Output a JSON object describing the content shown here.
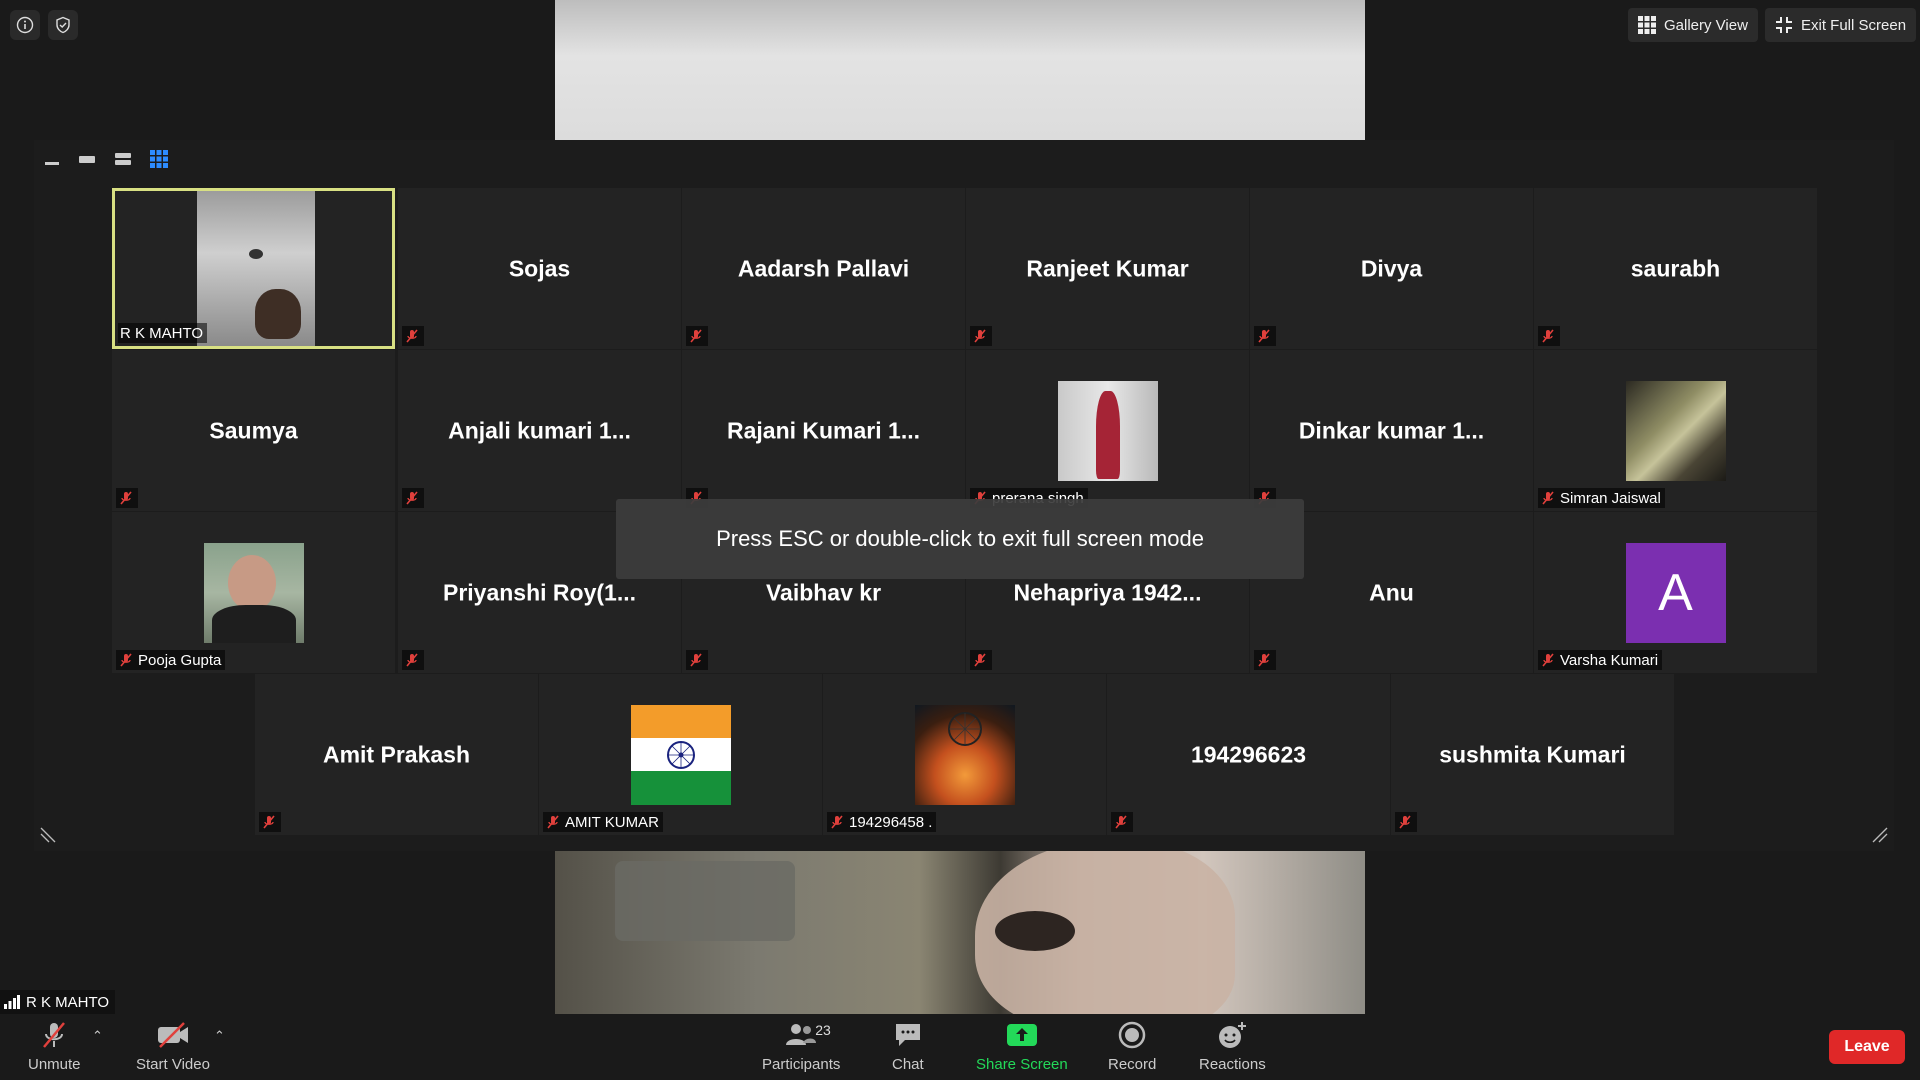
{
  "top": {
    "gallery_view_label": "Gallery View",
    "exit_full_screen_label": "Exit Full Screen"
  },
  "toast": {
    "text": "Press ESC or double-click to exit full screen mode"
  },
  "tiles": [
    {
      "name": "",
      "label": "R K MAHTO",
      "muted": false,
      "active": true
    },
    {
      "name": "Sojas",
      "label": "",
      "muted": true
    },
    {
      "name": "Aadarsh Pallavi",
      "label": "",
      "muted": true
    },
    {
      "name": "Ranjeet Kumar",
      "label": "",
      "muted": true
    },
    {
      "name": "Divya",
      "label": "",
      "muted": true
    },
    {
      "name": "saurabh",
      "label": "",
      "muted": true
    },
    {
      "name": "Saumya",
      "label": "",
      "muted": true
    },
    {
      "name": "Anjali kumari 1...",
      "label": "",
      "muted": true
    },
    {
      "name": "Rajani Kumari 1...",
      "label": "",
      "muted": true
    },
    {
      "name": "",
      "label": "prerana singh",
      "muted": true
    },
    {
      "name": "Dinkar kumar 1...",
      "label": "",
      "muted": true
    },
    {
      "name": "",
      "label": "Simran Jaiswal",
      "muted": true
    },
    {
      "name": "",
      "label": "Pooja Gupta",
      "muted": true
    },
    {
      "name": "Priyanshi Roy(1...",
      "label": "",
      "muted": true
    },
    {
      "name": "Vaibhav kr",
      "label": "",
      "muted": true
    },
    {
      "name": "Nehapriya 1942...",
      "label": "",
      "muted": true
    },
    {
      "name": "Anu",
      "label": "",
      "muted": true
    },
    {
      "name": "",
      "label": "Varsha Kumari",
      "muted": true,
      "avatar_letter": "A"
    },
    {
      "name": "Amit Prakash",
      "label": "",
      "muted": true
    },
    {
      "name": "",
      "label": "AMIT KUMAR",
      "muted": true
    },
    {
      "name": "",
      "label": "194296458 .",
      "muted": true
    },
    {
      "name": "194296623",
      "label": "",
      "muted": true
    },
    {
      "name": "sushmita Kumari",
      "label": "",
      "muted": true
    }
  ],
  "self": {
    "name": "R K MAHTO"
  },
  "toolbar": {
    "unmute": "Unmute",
    "start_video": "Start Video",
    "participants": "Participants",
    "participants_count": "23",
    "chat": "Chat",
    "share_screen": "Share Screen",
    "record": "Record",
    "reactions": "Reactions",
    "leave": "Leave"
  },
  "colors": {
    "active_border": "#d8e083",
    "share_green": "#23d959",
    "leave_red": "#e02828",
    "avatar_purple": "#7b2fb0"
  }
}
